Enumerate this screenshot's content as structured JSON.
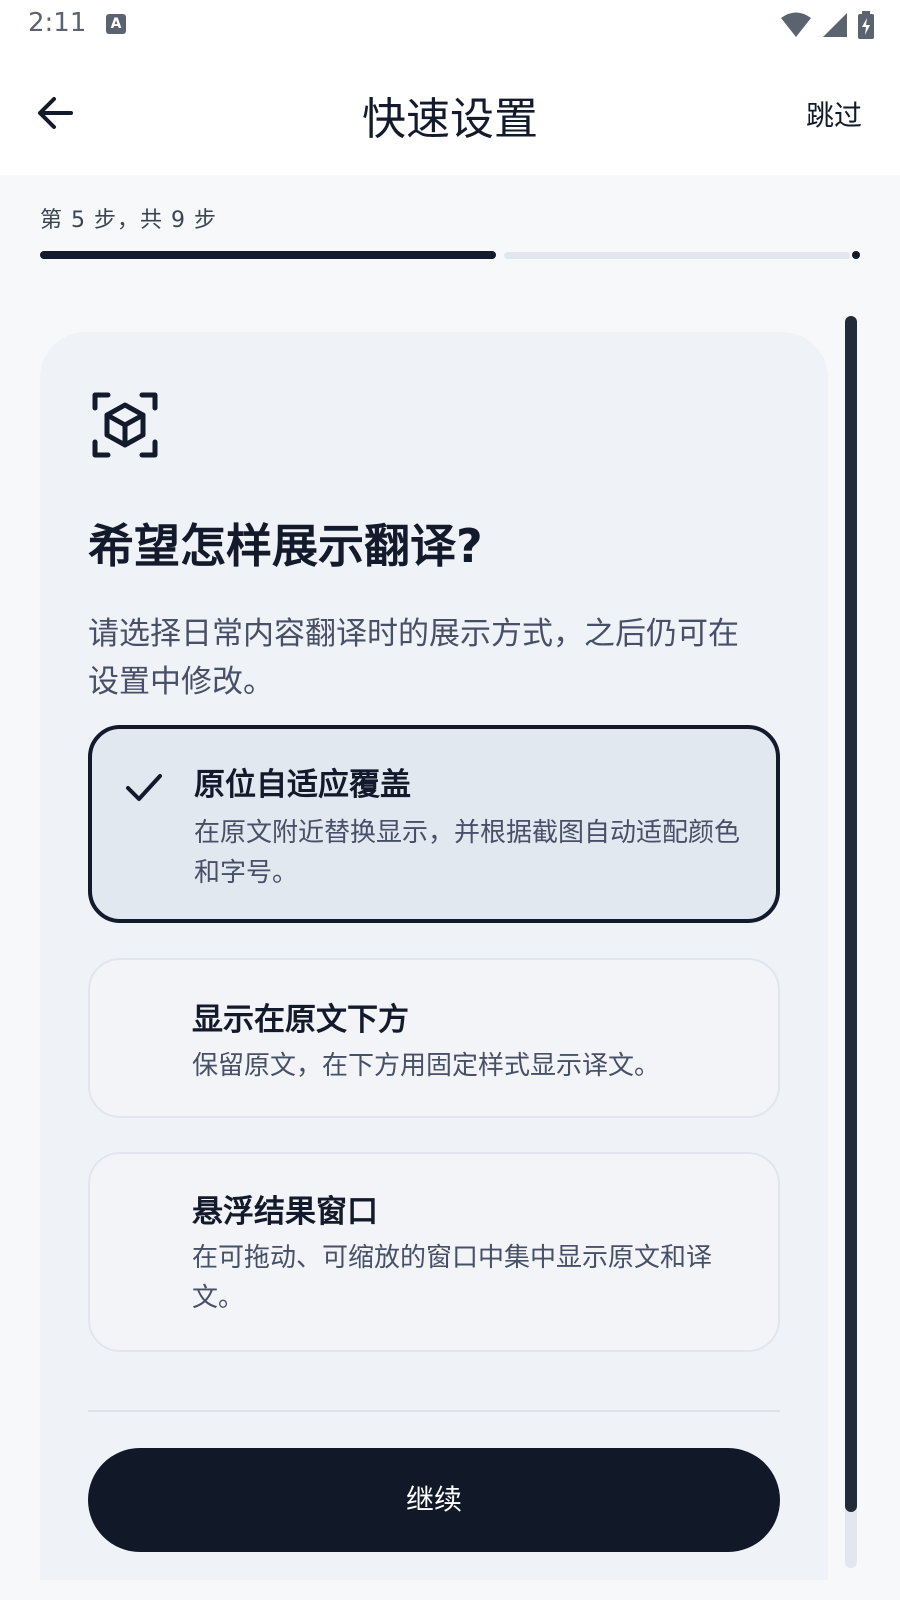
{
  "status_bar": {
    "time": "2:11",
    "notification_icon": "a-icon",
    "wifi_icon": "wifi-icon",
    "signal_icon": "signal-icon",
    "battery_icon": "battery-charging-icon"
  },
  "app_bar": {
    "back_icon": "arrow-left-icon",
    "title": "快速设置",
    "skip_label": "跳过"
  },
  "progress": {
    "step_text": "第 5 步，共 9 步",
    "current_step": 5,
    "total_steps": 9
  },
  "card": {
    "icon": "cube-scan-icon",
    "title": "希望怎样展示翻译?",
    "description": "请选择日常内容翻译时的展示方式，之后仍可在设置中修改。",
    "options": [
      {
        "title": "原位自适应覆盖",
        "description": "在原文附近替换显示，并根据截图自动适配颜色和字号。",
        "selected": true
      },
      {
        "title": "显示在原文下方",
        "description": "保留原文，在下方用固定样式显示译文。",
        "selected": false
      },
      {
        "title": "悬浮结果窗口",
        "description": "在可拖动、可缩放的窗口中集中显示原文和译文。",
        "selected": false
      }
    ],
    "continue_label": "继续"
  },
  "colors": {
    "primary": "#111827",
    "selected_bg": "#e2e8f0",
    "track": "#e2e7ef"
  }
}
